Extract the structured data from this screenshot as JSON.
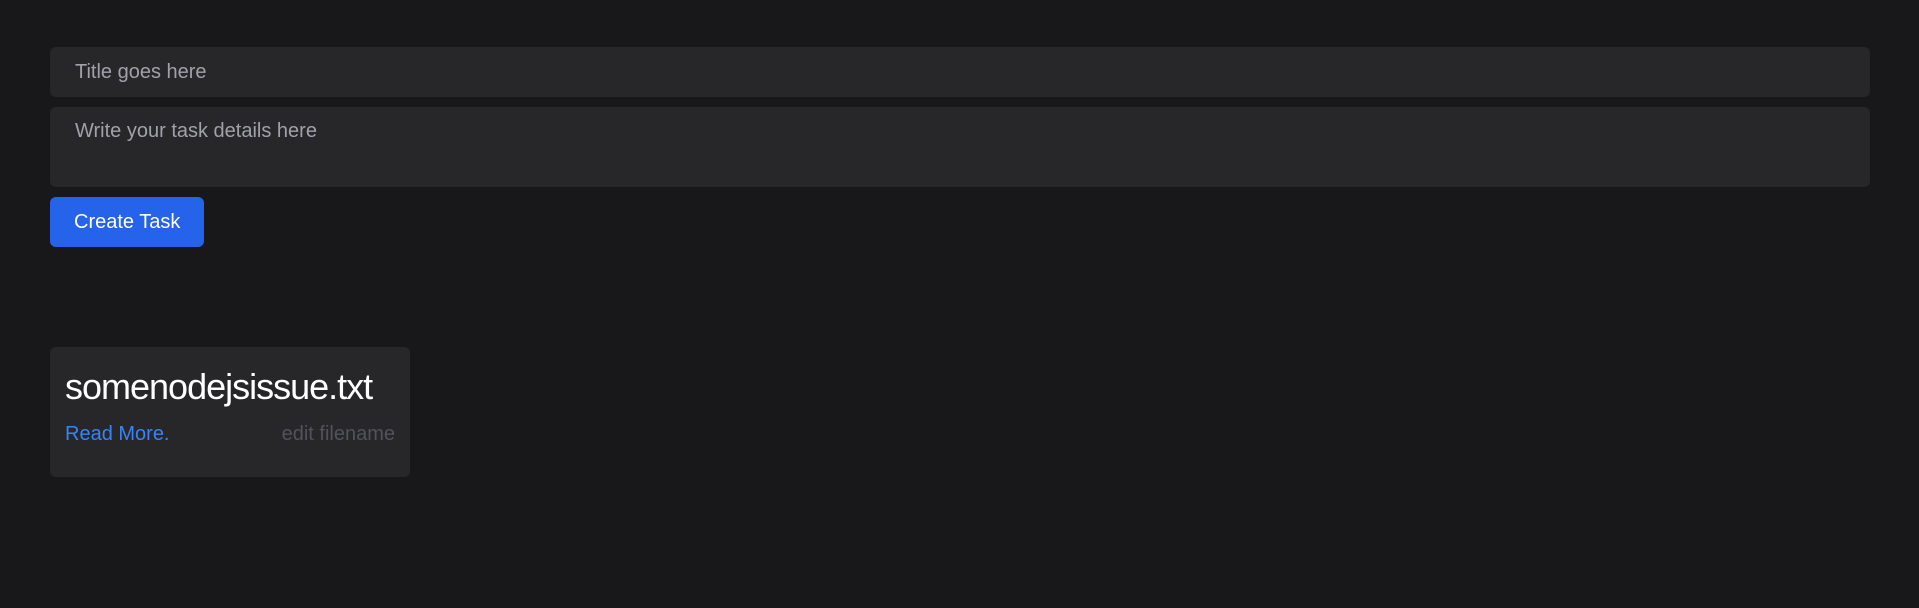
{
  "form": {
    "title_placeholder": "Title goes here",
    "title_value": "",
    "details_placeholder": "Write your task details here",
    "details_value": "",
    "create_label": "Create Task"
  },
  "tasks": [
    {
      "filename": "somenodejsissue.txt",
      "read_more_label": "Read More.",
      "edit_label": "edit filename"
    }
  ],
  "colors": {
    "background": "#18181b",
    "surface": "#27272a",
    "accent": "#2563eb",
    "link": "#3b82f6",
    "muted": "#52525b"
  }
}
